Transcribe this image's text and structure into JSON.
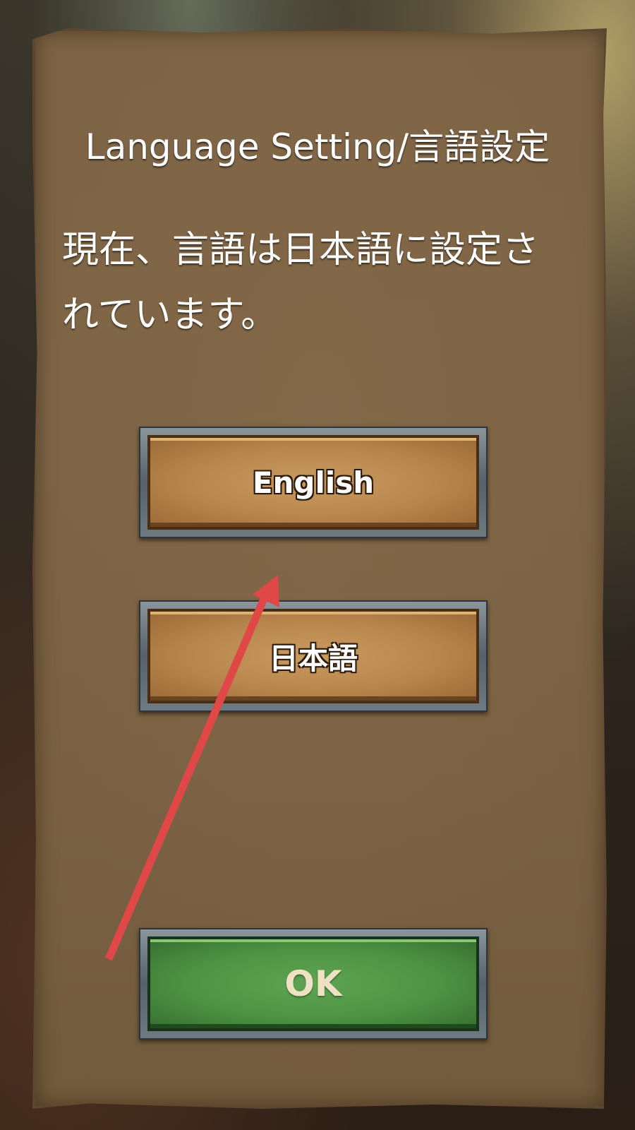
{
  "dialog": {
    "title": "Language Setting/言語設定",
    "message_line1": "現在、言語は日本語に設定さ",
    "message_line2": "れています。"
  },
  "buttons": {
    "english_label": "English",
    "japanese_label": "日本語",
    "ok_label": "OK"
  },
  "colors": {
    "annotation_arrow": "#e04848",
    "ok_button": "#4d9343",
    "option_button": "#b8864d"
  },
  "annotation": {
    "icon": "arrow-icon"
  }
}
